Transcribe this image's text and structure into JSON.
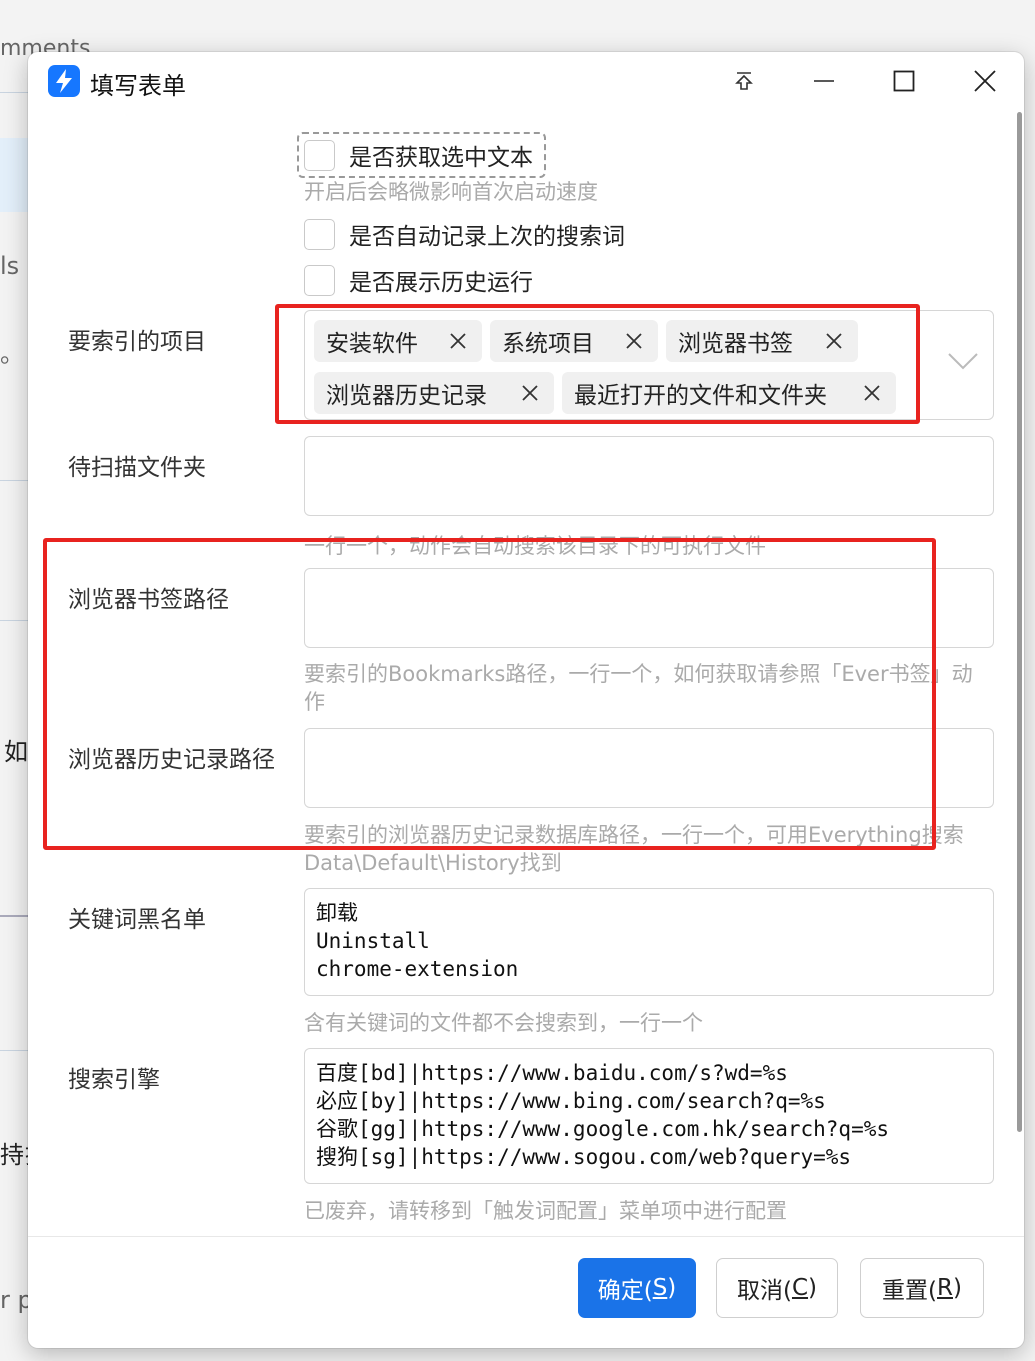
{
  "background": {
    "fragments": [
      "mments",
      "ls",
      "。",
      "如",
      "持扌",
      "r p"
    ]
  },
  "window": {
    "title": "填写表单"
  },
  "form": {
    "checkboxes": [
      {
        "label": "是否获取选中文本",
        "checked": false,
        "hint": "开启后会略微影响首次启动速度"
      },
      {
        "label": "是否自动记录上次的搜索词",
        "checked": false
      },
      {
        "label": "是否展示历史运行",
        "checked": false
      }
    ],
    "index_items": {
      "label": "要索引的项目",
      "tags": [
        "安装软件",
        "系统项目",
        "浏览器书签",
        "浏览器历史记录",
        "最近打开的文件和文件夹"
      ]
    },
    "scan_folder": {
      "label": "待扫描文件夹",
      "value": "",
      "hint": "一行一个，动作会自动搜索该目录下的可执行文件"
    },
    "bookmark_path": {
      "label": "浏览器书签路径",
      "value": "",
      "hint_line1": "要索引的Bookmarks路径，一行一个，如何获取请参照「Ever书签」动",
      "hint_line2": "作"
    },
    "history_path": {
      "label": "浏览器历史记录路径",
      "value": "",
      "hint_line1": "要索引的浏览器历史记录数据库路径，一行一个，可用Everything搜索",
      "hint_line2": "Data\\Default\\History找到"
    },
    "keyword_blacklist": {
      "label": "关键词黑名单",
      "value": "卸载\nUninstall\nchrome-extension",
      "hint": "含有关键词的文件都不会搜索到，一行一个"
    },
    "search_engine": {
      "label": "搜索引擎",
      "value": "百度[bd]|https://www.baidu.com/s?wd=%s\n必应[by]|https://www.bing.com/search?q=%s\n谷歌[gg]|https://www.google.com.hk/search?q=%s\n搜狗[sg]|https://www.sogou.com/web?query=%s",
      "hint": "已废弃，请转移到「触发词配置」菜单项中进行配置"
    }
  },
  "buttons": {
    "ok": {
      "text": "确定(",
      "key": "S",
      "end": ")"
    },
    "cancel": {
      "text": "取消(",
      "key": "C",
      "end": ")"
    },
    "reset": {
      "text": "重置(",
      "key": "R",
      "end": ")"
    }
  },
  "colors": {
    "accent": "#1a73e8",
    "annotation": "#e8231f",
    "hint": "#aaaaaa"
  }
}
